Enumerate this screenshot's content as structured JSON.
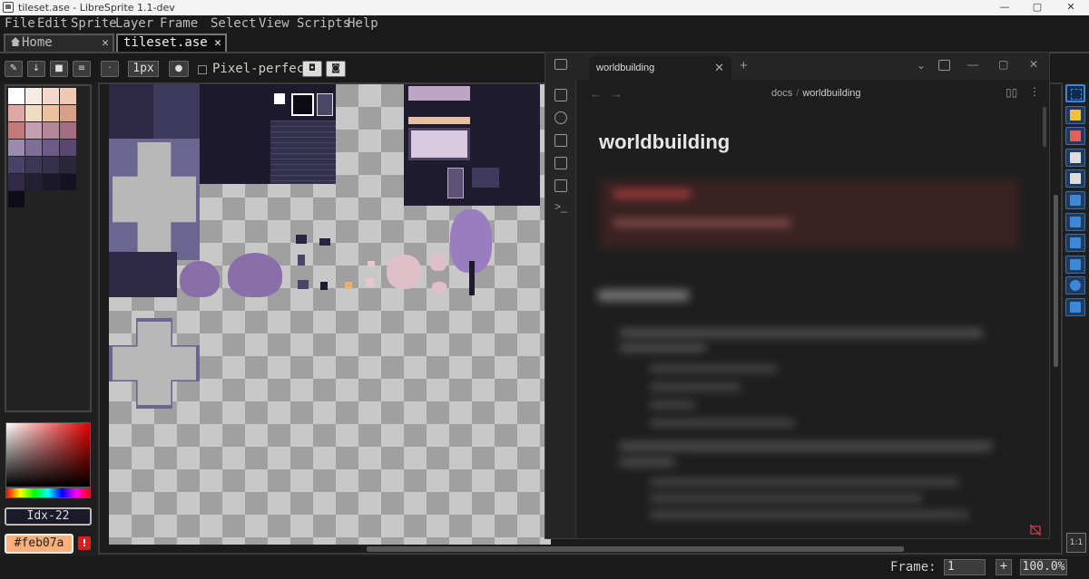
{
  "window": {
    "title": "tileset.ase - LibreSprite 1.1-dev",
    "controls": [
      "—",
      "▢",
      "✕"
    ]
  },
  "menubar": {
    "items": [
      "File",
      "Edit",
      "Sprite",
      "Layer",
      "Frame",
      "Select",
      "View",
      "Scripts",
      "Help"
    ]
  },
  "tabs": [
    {
      "label": "Home",
      "close": "✕"
    },
    {
      "label": "tileset.ase",
      "close": "✕",
      "active": true
    }
  ],
  "context_bar": {
    "brush_size": "1px",
    "pixel_perfect_label": "Pixel-perfect",
    "pixel_perfect_checked": false
  },
  "palette": {
    "colors": [
      "#ffffff",
      "#f5ece3",
      "#f2d8cd",
      "#efc9b0",
      "#e0a8a4",
      "#f0dcc0",
      "#ebc2a0",
      "#d8a086",
      "#c47a7a",
      "#c2a0b0",
      "#b28898",
      "#a26e80",
      "#9a8ab0",
      "#7f6e96",
      "#6e5a86",
      "#584870",
      "#484268",
      "#3c3656",
      "#36304c",
      "#2a263c",
      "#302a48",
      "#221e34",
      "#1a1728",
      "#141220",
      "#0e0c18"
    ],
    "selected_index_label": "Idx-22",
    "hex_value": "#feb07a",
    "accent": "#feb07a"
  },
  "status_bar": {
    "frame_label": "Frame:",
    "frame_value": "1",
    "add_frame": "+",
    "zoom": "100.0%"
  },
  "tools": [
    "rectangular-marquee-icon",
    "pencil-icon",
    "eraser-icon",
    "eyedropper-icon",
    "zoom-icon",
    "move-icon",
    "paint-bucket-icon",
    "line-icon",
    "rectangle-icon",
    "filled-ellipse-icon",
    "blur-icon"
  ],
  "one_to_one_label": "1:1",
  "obsidian": {
    "tab_title": "worldbuilding",
    "new_tab": "+",
    "breadcrumb": {
      "folder": "docs",
      "separator": "/",
      "file": "worldbuilding"
    },
    "note_title": "worldbuilding",
    "window_controls": [
      "—",
      "▢",
      "✕"
    ]
  }
}
